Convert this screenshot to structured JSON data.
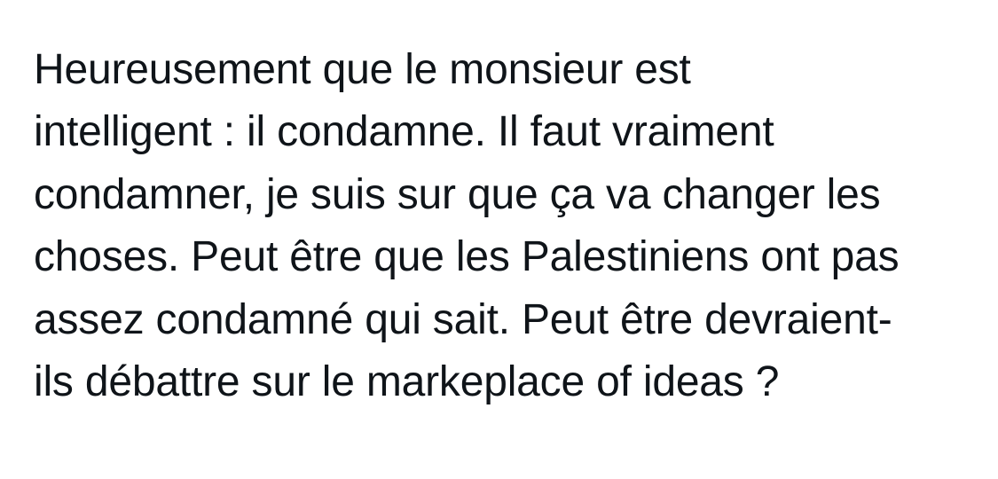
{
  "post": {
    "lines": [
      "Heureusement que le monsieur est",
      "intelligent : il condamne. Il faut vraiment",
      "condamner, je suis sur que ça va changer les",
      "choses. Peut être que les Palestiniens ont pas",
      "assez condamné qui sait. Peut être devraient-",
      "ils débattre sur le markeplace of ideas ?"
    ]
  }
}
